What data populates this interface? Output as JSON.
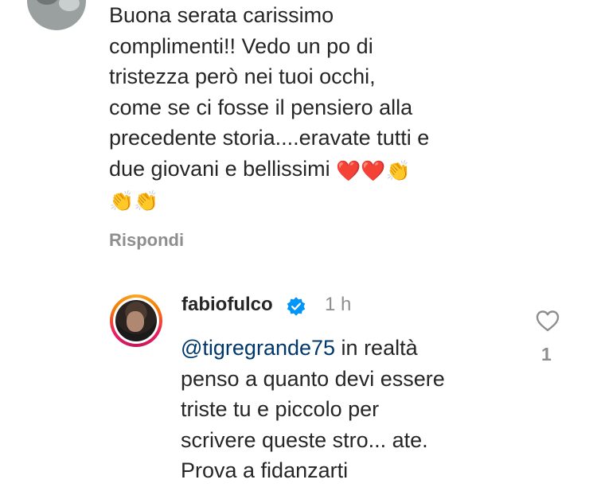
{
  "comment1": {
    "lines": [
      "Buona serata carissimo",
      "complimenti!! Vedo un po di",
      "tristezza però nei tuoi occhi,",
      "come se ci fosse il pensiero alla",
      "precedente storia....eravate tutti e",
      "due giovani e bellissimi"
    ],
    "emoji_heart": "❤️",
    "emoji_clap": "👏",
    "reply_label": "Rispondi"
  },
  "reply": {
    "username": "fabiofulco",
    "time": "1 h",
    "mention": "@tigregrande75",
    "text_first": " in realtà",
    "lines": [
      "penso a quanto devi essere",
      "triste tu e piccolo per",
      "scrivere queste stro... ate.",
      "Prova a fidanzarti"
    ],
    "like_count": "1"
  },
  "colors": {
    "text": "#262626",
    "secondary": "#8e8e8e",
    "mention": "#00376b",
    "verified": "#0095f6"
  }
}
